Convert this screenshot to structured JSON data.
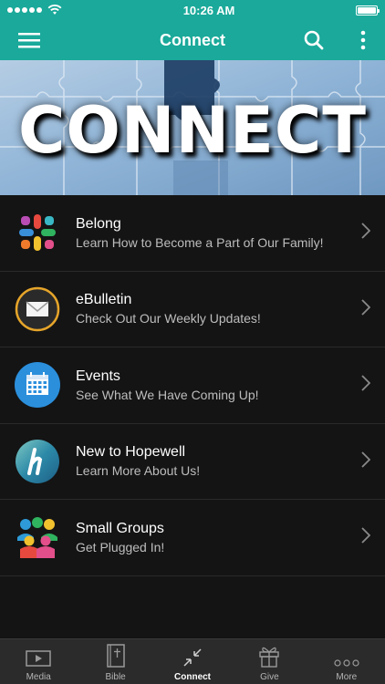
{
  "status_bar": {
    "time": "10:26 AM",
    "battery_level": 1.0
  },
  "nav": {
    "title": "Connect",
    "icons": [
      "menu-icon",
      "search-icon",
      "more-vertical-icon"
    ]
  },
  "banner": {
    "title": "CONNECT"
  },
  "list": [
    {
      "title": "Belong",
      "subtitle": "Learn How to Become a Part of Our Family!",
      "icon": "belong-icon"
    },
    {
      "title": "eBulletin",
      "subtitle": "Check Out Our Weekly Updates!",
      "icon": "envelope-icon"
    },
    {
      "title": "Events",
      "subtitle": "See What We Have Coming Up!",
      "icon": "calendar-icon"
    },
    {
      "title": "New to Hopewell",
      "subtitle": "Learn More About Us!",
      "icon": "hopewell-logo-icon"
    },
    {
      "title": "Small Groups",
      "subtitle": "Get Plugged In!",
      "icon": "people-group-icon"
    }
  ],
  "tabs": [
    {
      "label": "Media",
      "icon": "video-icon",
      "active": false
    },
    {
      "label": "Bible",
      "icon": "bible-icon",
      "active": false
    },
    {
      "label": "Connect",
      "icon": "connect-icon",
      "active": true
    },
    {
      "label": "Give",
      "icon": "gift-icon",
      "active": false
    },
    {
      "label": "More",
      "icon": "more-dots-icon",
      "active": false
    }
  ],
  "colors": {
    "accent": "#1aa99a",
    "background": "#141414",
    "tab_bar": "#2b2b2b"
  }
}
